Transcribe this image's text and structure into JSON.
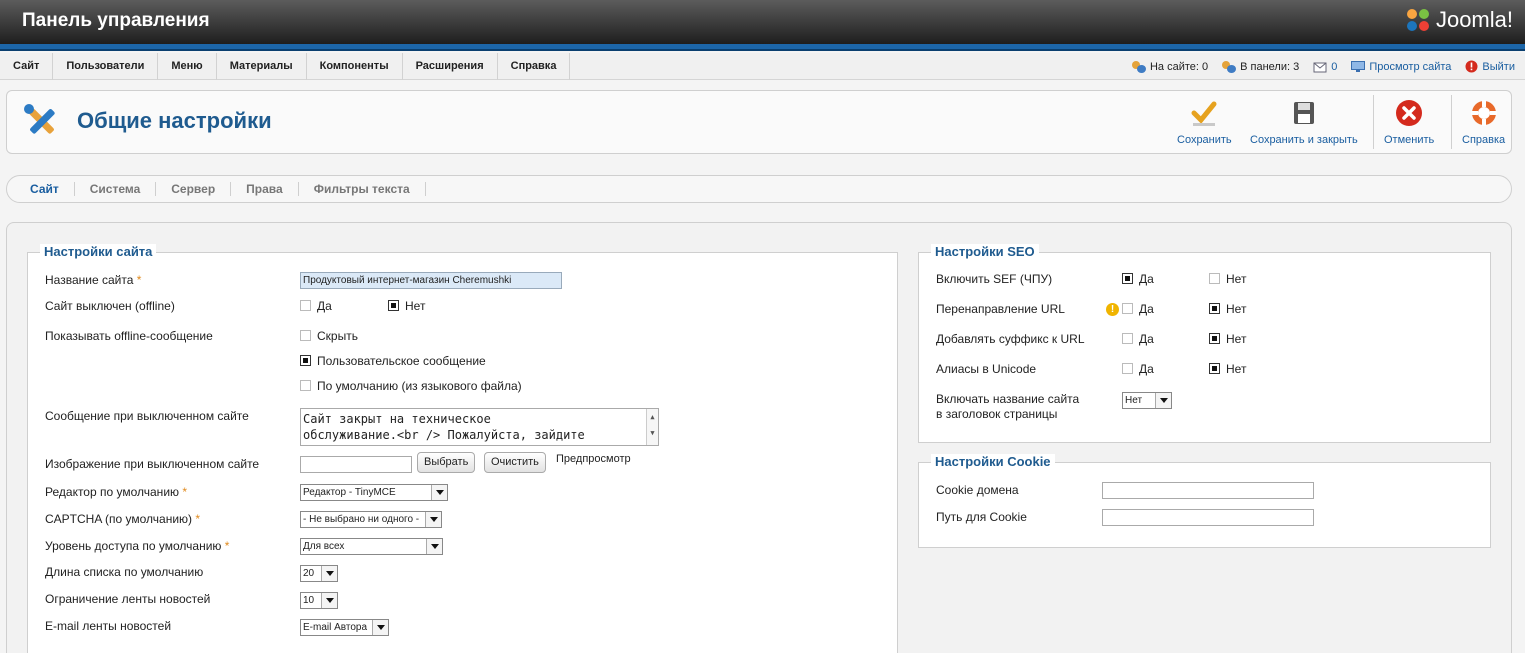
{
  "header": {
    "title": "Панель управления",
    "logo_text": "Joomla!"
  },
  "menu": {
    "items": [
      "Сайт",
      "Пользователи",
      "Меню",
      "Материалы",
      "Компоненты",
      "Расширения",
      "Справка"
    ]
  },
  "status": {
    "on_site": "На сайте: 0",
    "in_panel": "В панели: 3",
    "messages": "0",
    "view_site": "Просмотр сайта",
    "logout": "Выйти"
  },
  "toolbar": {
    "page_title": "Общие настройки",
    "save": "Сохранить",
    "save_close": "Сохранить и закрыть",
    "cancel": "Отменить",
    "help": "Справка"
  },
  "tabs": [
    "Сайт",
    "Система",
    "Сервер",
    "Права",
    "Фильтры текста"
  ],
  "site_settings": {
    "legend": "Настройки сайта",
    "site_name_label": "Название сайта",
    "site_name_value": "Продуктовый интернет-магазин Cheremushki",
    "offline_label": "Сайт выключен (offline)",
    "yes": "Да",
    "no": "Нет",
    "offline_msg_label": "Показывать offline-сообщение",
    "opt_hide": "Скрыть",
    "opt_custom": "Пользовательское сообщение",
    "opt_default": "По умолчанию (из языкового файла)",
    "offline_message_label": "Сообщение при выключенном сайте",
    "offline_message_line1": "Сайт закрыт на техническое",
    "offline_message_line2": "обслуживание.<br /> Пожалуйста, зайдите",
    "offline_image_label": "Изображение при выключенном сайте",
    "select_btn": "Выбрать",
    "clear_btn": "Очистить",
    "preview": "Предпросмотр",
    "editor_label": "Редактор по умолчанию",
    "editor_value": "Редактор - TinyMCE",
    "captcha_label": "CAPTCHA (по умолчанию)",
    "captcha_value": "- Не выбрано ни одного -",
    "access_label": "Уровень доступа по умолчанию",
    "access_value": "Для всех",
    "list_limit_label": "Длина списка по умолчанию",
    "list_limit_value": "20",
    "feed_limit_label": "Ограничение ленты новостей",
    "feed_limit_value": "10",
    "feed_email_label": "E-mail ленты новостей",
    "feed_email_value": "E-mail Автора"
  },
  "seo_settings": {
    "legend": "Настройки SEO",
    "sef_label": "Включить SEF (ЧПУ)",
    "rewrite_label": "Перенаправление URL",
    "suffix_label": "Добавлять суффикс к URL",
    "unicode_label": "Алиасы в Unicode",
    "sitename_label_1": "Включать название сайта",
    "sitename_label_2": "в заголовок страницы",
    "sitename_value": "Нет",
    "yes": "Да",
    "no": "Нет"
  },
  "cookie_settings": {
    "legend": "Настройки Cookie",
    "domain_label": "Cookie домена",
    "path_label": "Путь для Cookie"
  }
}
